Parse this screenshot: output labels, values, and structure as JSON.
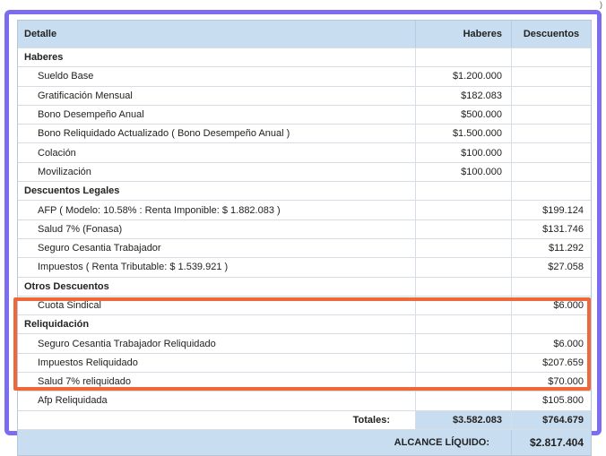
{
  "header": {
    "detail": "Detalle",
    "credits": "Haberes",
    "deductions": "Descuentos"
  },
  "sections": [
    {
      "title": "Haberes",
      "items": [
        {
          "label": "Sueldo Base",
          "credit": "$1.200.000",
          "debit": ""
        },
        {
          "label": "Gratificación Mensual",
          "credit": "$182.083",
          "debit": ""
        },
        {
          "label": "Bono Desempeño Anual",
          "credit": "$500.000",
          "debit": ""
        },
        {
          "label": "Bono Reliquidado Actualizado ( Bono Desempeño Anual )",
          "credit": "$1.500.000",
          "debit": ""
        },
        {
          "label": "Colación",
          "credit": "$100.000",
          "debit": ""
        },
        {
          "label": "Movilización",
          "credit": "$100.000",
          "debit": ""
        }
      ]
    },
    {
      "title": "Descuentos Legales",
      "items": [
        {
          "label": "AFP ( Modelo: 10.58% : Renta Imponible: $ 1.882.083 )",
          "credit": "",
          "debit": "$199.124"
        },
        {
          "label": "Salud 7% (Fonasa)",
          "credit": "",
          "debit": "$131.746"
        },
        {
          "label": "Seguro Cesantia Trabajador",
          "credit": "",
          "debit": "$11.292"
        },
        {
          "label": "Impuestos ( Renta Tributable: $ 1.539.921 )",
          "credit": "",
          "debit": "$27.058"
        }
      ]
    },
    {
      "title": "Otros Descuentos",
      "items": [
        {
          "label": "Cuota Sindical",
          "credit": "",
          "debit": "$6.000"
        }
      ]
    },
    {
      "title": "Reliquidación",
      "items": [
        {
          "label": "Seguro Cesantia Trabajador Reliquidado",
          "credit": "",
          "debit": "$6.000"
        },
        {
          "label": "Impuestos Reliquidado",
          "credit": "",
          "debit": "$207.659"
        },
        {
          "label": "Salud 7% reliquidado",
          "credit": "",
          "debit": "$70.000"
        },
        {
          "label": "Afp Reliquidada",
          "credit": "",
          "debit": "$105.800"
        }
      ]
    }
  ],
  "totals": {
    "label": "Totales:",
    "credit": "$3.582.083",
    "debit": "$764.679"
  },
  "net": {
    "label": "ALCANCE LÍQUIDO:",
    "value": "$2.817.404"
  },
  "corner_mark": ")",
  "colors": {
    "frame": "#7b6cf0",
    "highlight": "#f0683a",
    "header_bg": "#c8ddef"
  }
}
